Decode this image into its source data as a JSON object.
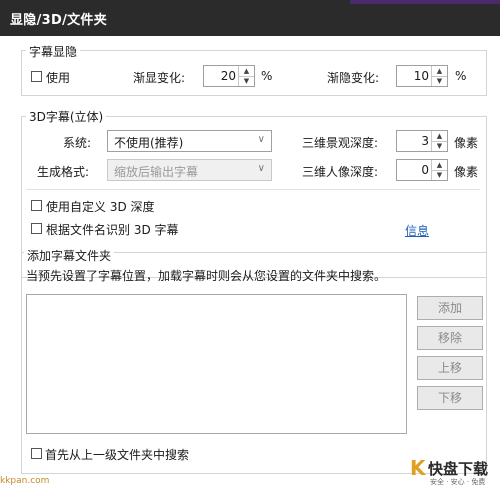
{
  "window": {
    "title": "显隐/3D/文件夹"
  },
  "fade": {
    "legend": "字幕显隐",
    "use_label": "使用",
    "fade_in_label": "渐显变化:",
    "fade_in_value": "20",
    "fade_in_unit": "%",
    "fade_out_label": "渐隐变化:",
    "fade_out_value": "10",
    "fade_out_unit": "%"
  },
  "s3d": {
    "legend": "3D字幕(立体)",
    "system_label": "系统:",
    "system_value": "不使用(推荐)",
    "format_label": "生成格式:",
    "format_value": "缩放后输出字幕",
    "scene_depth_label": "三维景观深度:",
    "scene_depth_value": "3",
    "scene_depth_unit": "像素",
    "person_depth_label": "三维人像深度:",
    "person_depth_value": "0",
    "person_depth_unit": "像素",
    "custom_depth_label": "使用自定义 3D 深度",
    "filename_detect_label": "根据文件名识别 3D 字幕",
    "info_link": "信息"
  },
  "folders": {
    "legend": "添加字幕文件夹",
    "description": "当预先设置了字幕位置，加载字幕时则会从您设置的文件夹中搜索。",
    "buttons": {
      "add": "添加",
      "remove": "移除",
      "up": "上移",
      "down": "下移"
    },
    "first_search_label": "首先从上一级文件夹中搜索"
  },
  "watermark": {
    "site": "kkpan.com",
    "brand": "快盘下载",
    "brand_k": "K",
    "brand_sub": "安全 · 安心 · 免费"
  },
  "colors": {
    "titlebar": "#2b2b2b",
    "link": "#1f5fb3",
    "brand": "#e0a020"
  }
}
